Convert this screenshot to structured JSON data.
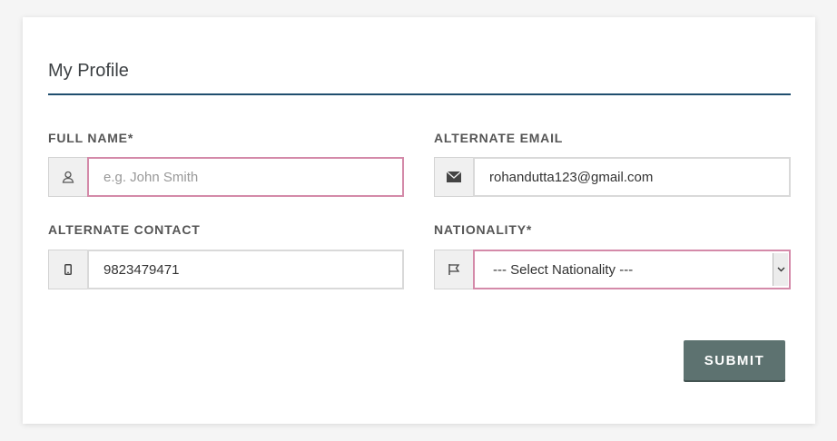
{
  "form": {
    "title": "My Profile",
    "full_name": {
      "label": "FULL NAME*",
      "value": "",
      "placeholder": "e.g. John Smith",
      "icon": "user-icon"
    },
    "alternate_email": {
      "label": "ALTERNATE EMAIL",
      "value": "rohandutta123@gmail.com",
      "icon": "envelope-icon"
    },
    "alternate_contact": {
      "label": "ALTERNATE CONTACT",
      "value": "9823479471",
      "icon": "mobile-phone-icon"
    },
    "nationality": {
      "label": "NATIONALITY*",
      "selected": "--- Select Nationality ---",
      "icon": "flag-icon"
    },
    "submit_label": "SUBMIT"
  },
  "colors": {
    "accent_rule": "#1f4e6e",
    "invalid_border": "#d48aa9",
    "submit_bg": "#5d7270"
  }
}
